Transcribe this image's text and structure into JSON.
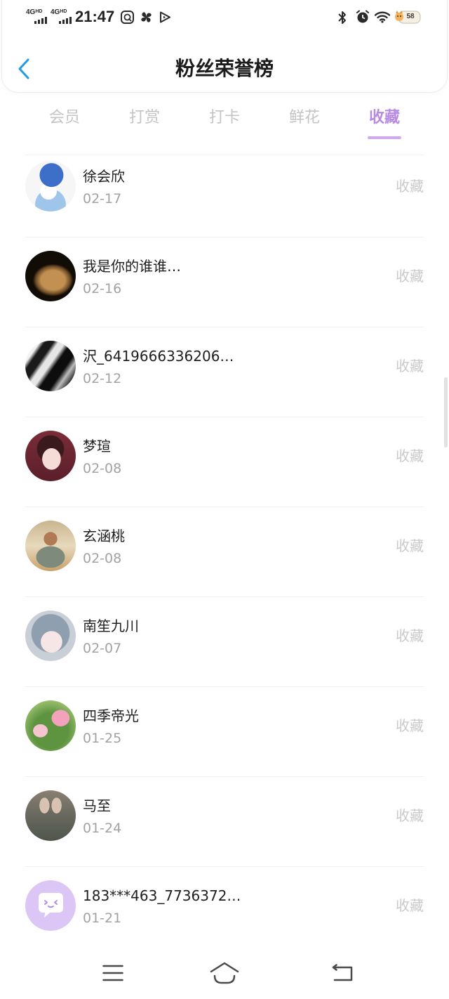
{
  "status_bar": {
    "sim1": {
      "network": "4G",
      "hd": "HD"
    },
    "sim2": {
      "network": "4G",
      "hd": "HD"
    },
    "time": "21:47",
    "battery_level": "58",
    "left_icons": [
      "assistant-app-icon",
      "fan-icon",
      "play-icon"
    ],
    "right_icons": [
      "bluetooth-icon",
      "alarm-icon",
      "wifi-icon",
      "battery-icon"
    ]
  },
  "header": {
    "title": "粉丝荣誉榜",
    "back_icon": "chevron-left-icon"
  },
  "tabs": [
    {
      "label": "会员",
      "active": false
    },
    {
      "label": "打赏",
      "active": false
    },
    {
      "label": "打卡",
      "active": false
    },
    {
      "label": "鲜花",
      "active": false
    },
    {
      "label": "收藏",
      "active": true
    }
  ],
  "fans": [
    {
      "name": "徐会欣",
      "date": "02-17",
      "action": "收藏"
    },
    {
      "name": "我是你的谁谁…",
      "date": "02-16",
      "action": "收藏"
    },
    {
      "name": "沢_6419666336206…",
      "date": "02-12",
      "action": "收藏"
    },
    {
      "name": "梦瑄",
      "date": "02-08",
      "action": "收藏"
    },
    {
      "name": "玄涵桃",
      "date": "02-08",
      "action": "收藏"
    },
    {
      "name": "南笙九川",
      "date": "02-07",
      "action": "收藏"
    },
    {
      "name": "四季帝光",
      "date": "01-25",
      "action": "收藏"
    },
    {
      "name": "马至",
      "date": "01-24",
      "action": "收藏"
    },
    {
      "name": "183***463_7736372…",
      "date": "01-21",
      "action": "收藏"
    }
  ],
  "nav_bar": {
    "icons": [
      "menu-icon",
      "home-icon",
      "back-icon"
    ]
  },
  "colors": {
    "accent": "#b889e3",
    "tab_underline": "#cfaaf0",
    "back_arrow": "#1f9be8",
    "inactive_tab": "#c4c4c4",
    "date_text": "#a2a2a2",
    "action_text": "#c9c9c9"
  }
}
